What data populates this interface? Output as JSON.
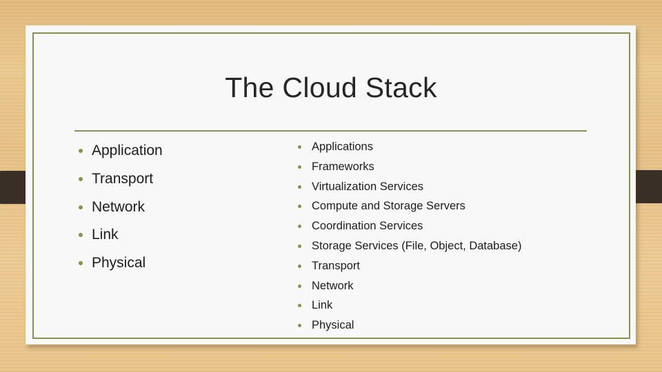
{
  "slide": {
    "title": "The Cloud Stack",
    "accent_color": "#86924f",
    "left_column": {
      "items": [
        "Application",
        "Transport",
        "Network",
        "Link",
        "Physical"
      ]
    },
    "right_column": {
      "items": [
        "Applications",
        "Frameworks",
        "Virtualization Services",
        "Compute and Storage Servers",
        "Coordination Services",
        "Storage Services (File, Object, Database)",
        "Transport",
        "Network",
        "Link",
        "Physical"
      ]
    }
  }
}
